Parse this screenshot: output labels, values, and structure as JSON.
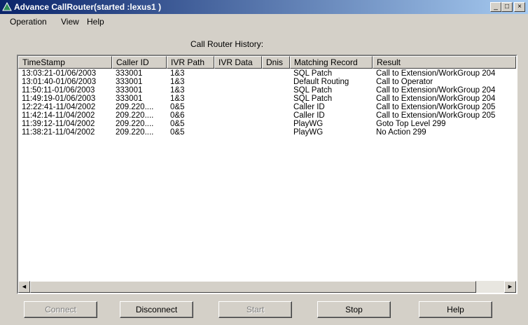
{
  "window": {
    "title": "Advance CallRouter(started :lexus1 )",
    "controls": {
      "minimize": "_",
      "maximize": "□",
      "close": "×"
    }
  },
  "menu": [
    "Operation",
    "View",
    "Help"
  ],
  "history_label": "Call Router History:",
  "table": {
    "columns": [
      "TimeStamp",
      "Caller ID",
      "IVR Path",
      "IVR Data",
      "Dnis",
      "Matching Record",
      "Result"
    ],
    "rows": [
      [
        "13:03:21-01/06/2003",
        "333001",
        "1&3",
        "",
        "",
        "SQL Patch",
        "Call to Extension/WorkGroup 204"
      ],
      [
        "13:01:40-01/06/2003",
        "333001",
        "1&3",
        "",
        "",
        "Default Routing",
        "Call to Operator"
      ],
      [
        "11:50:11-01/06/2003",
        "333001",
        "1&3",
        "",
        "",
        "SQL Patch",
        "Call to Extension/WorkGroup 204"
      ],
      [
        "11:49:19-01/06/2003",
        "333001",
        "1&3",
        "",
        "",
        "SQL Patch",
        "Call to Extension/WorkGroup 204"
      ],
      [
        "12:22:41-11/04/2002",
        "209.220....",
        "0&5",
        "",
        "",
        "Caller ID",
        "Call to Extension/WorkGroup 205"
      ],
      [
        "11:42:14-11/04/2002",
        "209.220....",
        "0&6",
        "",
        "",
        "Caller ID",
        "Call to Extension/WorkGroup 205"
      ],
      [
        "11:39:12-11/04/2002",
        "209.220....",
        "0&5",
        "",
        "",
        "PlayWG",
        "Goto Top Level 299"
      ],
      [
        "11:38:21-11/04/2002",
        "209.220....",
        "0&5",
        "",
        "",
        "PlayWG",
        "No Action 299"
      ]
    ]
  },
  "scrollbar": {
    "left_arrow": "◄",
    "right_arrow": "►"
  },
  "buttons": {
    "connect": "Connect",
    "disconnect": "Disconnect",
    "start": "Start",
    "stop": "Stop",
    "help": "Help"
  }
}
